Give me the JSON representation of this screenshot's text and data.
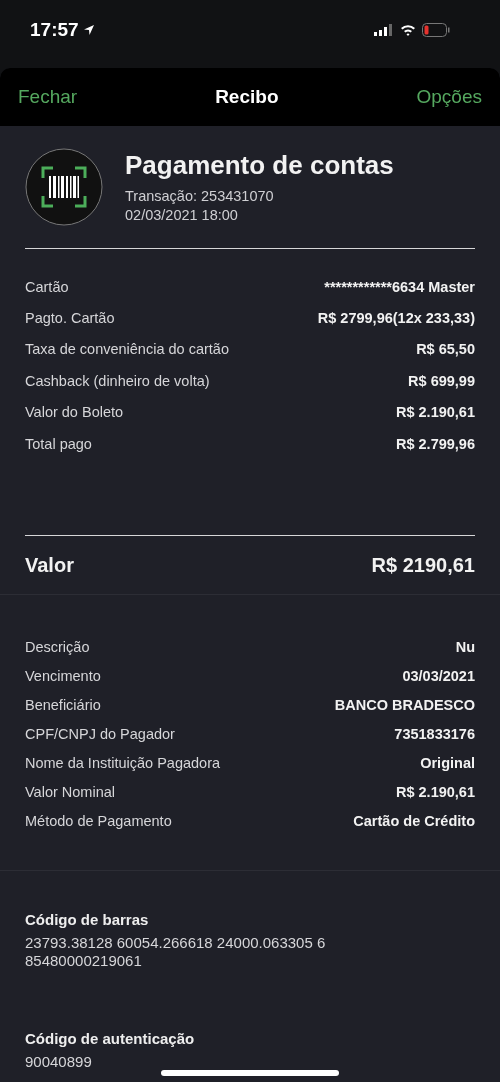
{
  "status_bar": {
    "time": "17:57"
  },
  "nav_bar": {
    "left": "Fechar",
    "title": "Recibo",
    "right": "Opções"
  },
  "header": {
    "title": "Pagamento de contas",
    "transaction": "Transação: 253431070",
    "datetime": "02/03/2021 18:00"
  },
  "payment_rows": [
    {
      "label": "Cartão",
      "value": "************6634 Master"
    },
    {
      "label": "Pagto. Cartão",
      "value": "R$ 2799,96(12x 233,33)"
    },
    {
      "label": "Taxa de conveniência do cartão",
      "value": "R$ 65,50"
    },
    {
      "label": "Cashback (dinheiro de volta)",
      "value": "R$ 699,99"
    },
    {
      "label": "Valor do Boleto",
      "value": "R$ 2.190,61"
    },
    {
      "label": "Total pago",
      "value": "R$ 2.799,96"
    }
  ],
  "total": {
    "label": "Valor",
    "value": "R$ 2190,61"
  },
  "detail_rows": [
    {
      "label": "Descrição",
      "value": "Nu"
    },
    {
      "label": "Vencimento",
      "value": "03/03/2021"
    },
    {
      "label": "Beneficiário",
      "value": "BANCO BRADESCO"
    },
    {
      "label": "CPF/CNPJ do Pagador",
      "value": "7351833176"
    },
    {
      "label": "Nome da Instituição Pagadora",
      "value": "Original"
    },
    {
      "label": "Valor Nominal",
      "value": "R$ 2.190,61"
    },
    {
      "label": "Método de Pagamento",
      "value": "Cartão de Crédito"
    }
  ],
  "codes": [
    {
      "label": "Código de barras",
      "value": "23793.38128 60054.266618 24000.063305 6 85480000219061"
    },
    {
      "label": "Código de autenticação",
      "value": "90040899"
    }
  ]
}
